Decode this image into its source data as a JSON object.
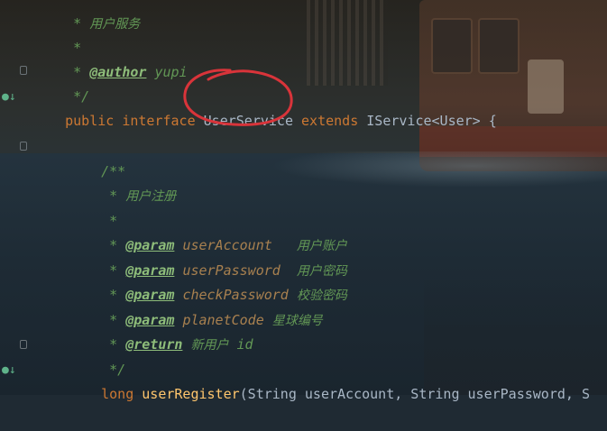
{
  "code": {
    "line1": {
      "star": " * ",
      "text": "用户服务"
    },
    "line2": {
      "star": " *"
    },
    "line3": {
      "star": " * ",
      "tag": "@author",
      "value": " yupi"
    },
    "line4": {
      "text": " */"
    },
    "line5": {
      "kw1": "public",
      "kw2": "interface",
      "name": "UserService",
      "kw3": "extends",
      "rest": "IService<User> {"
    },
    "line6": {
      "text": "/**"
    },
    "line7": {
      "star": " * ",
      "text": "用户注册"
    },
    "line8": {
      "star": " *"
    },
    "params": [
      {
        "star": " * ",
        "tag": "@param",
        "name": "userAccount",
        "desc": "用户账户"
      },
      {
        "star": " * ",
        "tag": "@param",
        "name": "userPassword",
        "desc": "用户密码"
      },
      {
        "star": " * ",
        "tag": "@param",
        "name": "checkPassword",
        "desc": "校验密码"
      },
      {
        "star": " * ",
        "tag": "@param",
        "name": "planetCode",
        "desc": "星球编号"
      }
    ],
    "ret": {
      "star": " * ",
      "tag": "@return",
      "name": "新用户",
      "desc": " id"
    },
    "close": {
      "text": " */"
    },
    "method": {
      "kw": "long",
      "name": "userRegister",
      "args": "(String userAccount, String userPassword, S"
    }
  },
  "colors": {
    "keyword": "#cc7832",
    "comment": "#629755",
    "method": "#ffc66d",
    "annotation_circle": "#d9343a"
  },
  "icons": [
    "fold-marker-icon",
    "implemented-marker-icon"
  ]
}
